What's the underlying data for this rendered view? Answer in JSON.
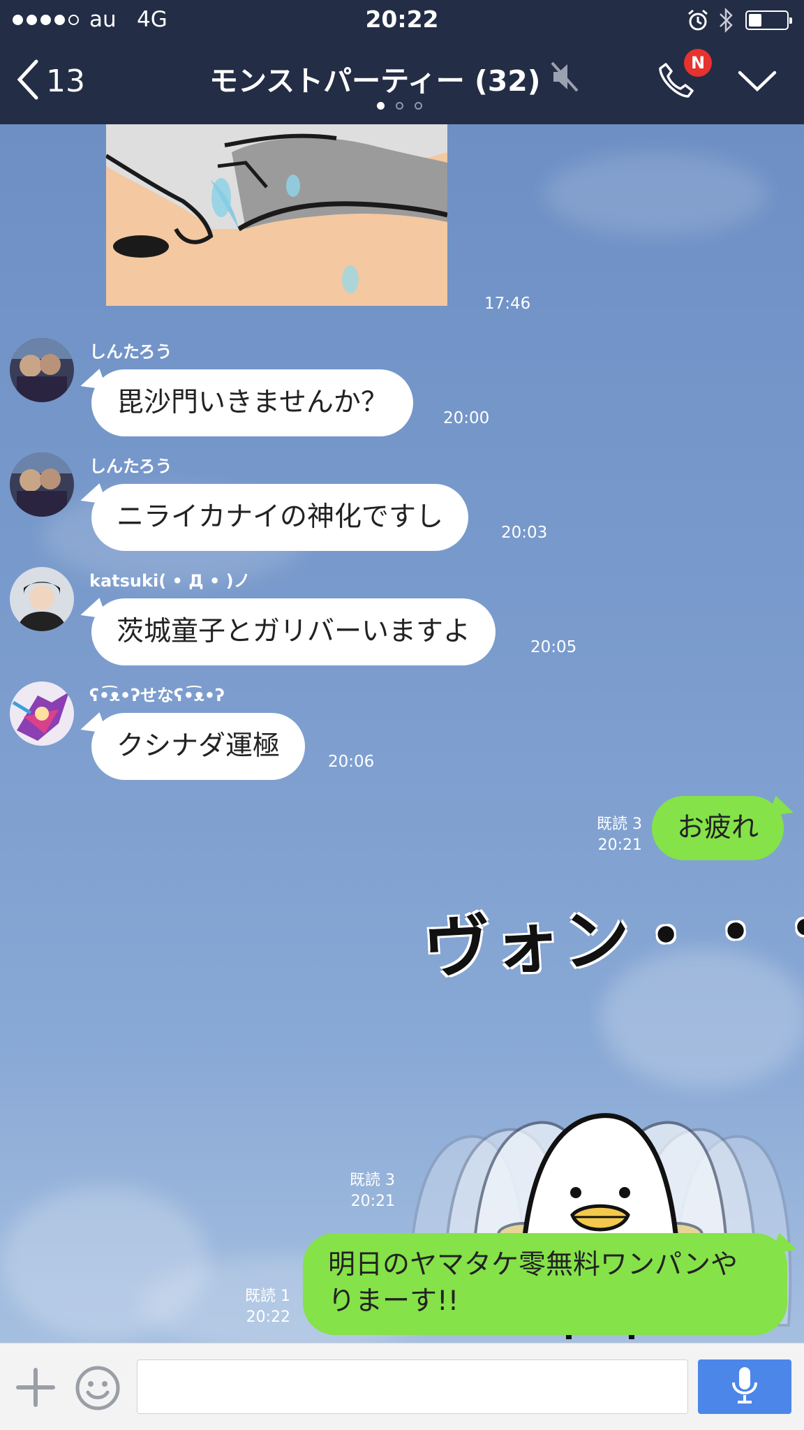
{
  "status_bar": {
    "carrier": "au",
    "network": "4G",
    "time": "20:22",
    "signal_bars": 4,
    "signal_max": 5,
    "battery_level": 0.35
  },
  "header": {
    "back_count": "13",
    "title": "モンストパーティー (32)",
    "call_badge": "N",
    "page_index": 0,
    "page_count": 3
  },
  "messages": {
    "photo": {
      "time": "17:46"
    },
    "m1": {
      "sender": "しんたろう",
      "text": "毘沙門いきませんか？",
      "time": "20:00"
    },
    "m2": {
      "sender": "しんたろう",
      "text": "ニライカナイの神化ですし",
      "time": "20:03"
    },
    "m3": {
      "sender": "katsuki( • Д • )ノ",
      "text": "茨城童子とガリバーいますよ",
      "time": "20:05"
    },
    "m4": {
      "sender": "ʕ•͡ᴥ•ʔせなʕ•͡ᴥ•ʔ",
      "text": "クシナダ運極",
      "time": "20:06"
    },
    "o1": {
      "read": "既読 3",
      "time": "20:21",
      "text": "お疲れ"
    },
    "o2": {
      "read": "既読 3",
      "time": "20:21",
      "sticker_text": "ヴォン・・・"
    },
    "o3": {
      "read": "既読 1",
      "time": "20:22",
      "text_line1": "明日のヤマタケ零無料ワンパンや",
      "text_line2": "りまーす!!"
    }
  },
  "input": {
    "placeholder": ""
  },
  "colors": {
    "bar_bg": "#232d45",
    "chat_bg": "#7a98c6",
    "bubble_out": "#85e249",
    "bubble_in": "#ffffff",
    "badge": "#e8322d",
    "mic_button": "#4c86e8"
  },
  "icons": [
    "back-chevron-icon",
    "mute-icon",
    "phone-icon",
    "chevron-down-icon",
    "alarm-icon",
    "bluetooth-icon",
    "battery-icon",
    "plus-icon",
    "emoji-icon",
    "microphone-icon"
  ]
}
